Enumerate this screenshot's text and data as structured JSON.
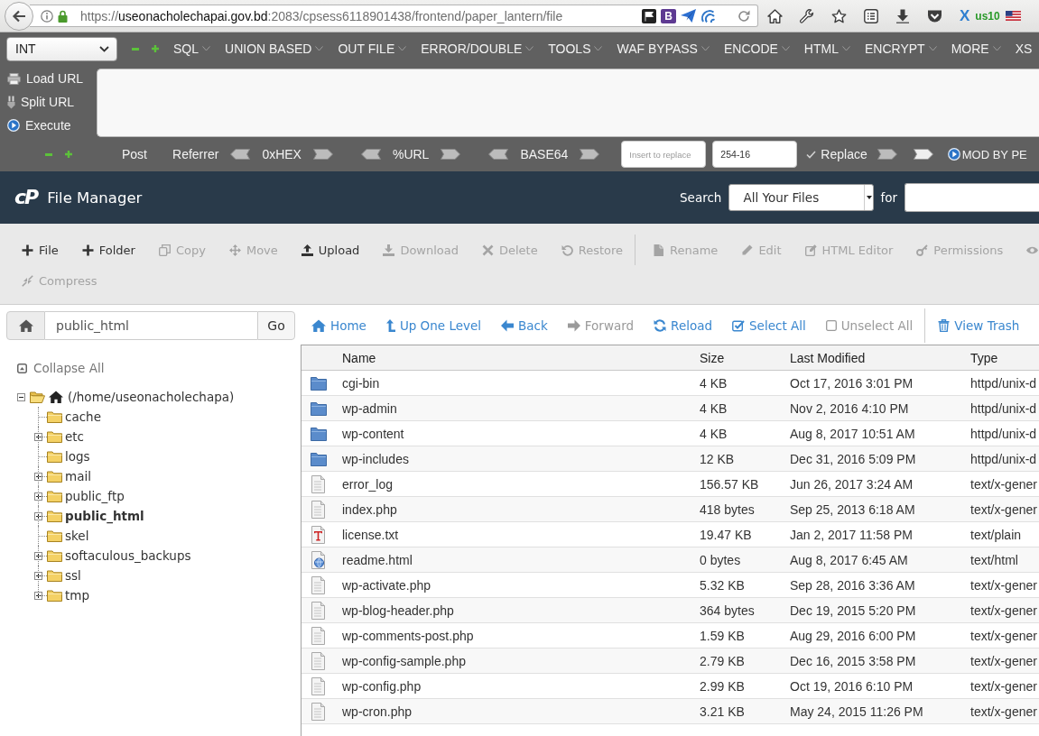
{
  "browser": {
    "url": {
      "scheme": "https://",
      "host": "useonacholechapai.gov.bd",
      "path": ":2083/cpsess6118901438/frontend/paper_lantern/file"
    },
    "extension_badge": "B",
    "extension_letter": "X",
    "vpn_label": "us10"
  },
  "hackbar": {
    "type_select": "INT",
    "menus": [
      {
        "label": "SQL",
        "caret": true
      },
      {
        "label": "UNION BASED",
        "caret": true
      },
      {
        "label": "OUT FILE",
        "caret": true
      },
      {
        "label": "ERROR/DOUBLE",
        "caret": true
      },
      {
        "label": "TOOLS",
        "caret": true
      },
      {
        "label": "WAF BYPASS",
        "caret": true
      },
      {
        "label": "ENCODE",
        "caret": true
      },
      {
        "label": "HTML",
        "caret": true
      },
      {
        "label": "ENCRYPT",
        "caret": true
      },
      {
        "label": "MORE",
        "caret": true
      },
      {
        "label": "XS",
        "caret": false
      }
    ],
    "actions": [
      {
        "kind": "load",
        "label": "Load URL"
      },
      {
        "kind": "split",
        "label": "Split URL"
      },
      {
        "kind": "execute",
        "label": "Execute"
      }
    ],
    "options": [
      {
        "kind": "toggle",
        "label": "Post"
      },
      {
        "kind": "toggle",
        "label": "Referrer"
      },
      {
        "kind": "codec",
        "label": "0xHEX"
      },
      {
        "kind": "codec",
        "label": "%URL"
      },
      {
        "kind": "codec",
        "label": "BASE64"
      },
      {
        "kind": "field",
        "placeholder": "Insert to replace"
      },
      {
        "kind": "field",
        "value": "254-16"
      },
      {
        "kind": "check",
        "label": "Replace",
        "checked": true
      },
      {
        "kind": "swap"
      },
      {
        "kind": "mod",
        "label": "MOD BY PE"
      }
    ]
  },
  "app_header": {
    "logo": "cP",
    "title": "File Manager",
    "search_label": "Search",
    "search_scope": "All Your Files",
    "for_label": "for"
  },
  "toolbar": [
    {
      "groups": [
        {
          "items": [
            {
              "kind": "plus",
              "label": "File",
              "disabled": false
            },
            {
              "kind": "plus",
              "label": "Folder",
              "disabled": false
            },
            {
              "kind": "copy",
              "label": "Copy",
              "disabled": true
            },
            {
              "kind": "move",
              "label": "Move",
              "disabled": true
            },
            {
              "kind": "upload",
              "label": "Upload",
              "disabled": false
            },
            {
              "kind": "download",
              "label": "Download",
              "disabled": true
            },
            {
              "kind": "delete",
              "label": "Delete",
              "disabled": true
            },
            {
              "kind": "restore",
              "label": "Restore",
              "disabled": true
            }
          ]
        },
        {
          "items": [
            {
              "kind": "rename",
              "label": "Rename",
              "disabled": true
            },
            {
              "kind": "edit",
              "label": "Edit",
              "disabled": true
            },
            {
              "kind": "html-editor",
              "label": "HTML Editor",
              "disabled": true
            },
            {
              "kind": "permissions",
              "label": "Permissions",
              "disabled": true
            },
            {
              "kind": "view",
              "disabled": true
            }
          ]
        }
      ]
    },
    {
      "groups": [
        {
          "items": [
            {
              "kind": "compress",
              "label": "Compress",
              "disabled": true
            }
          ]
        }
      ]
    }
  ],
  "path_bar": {
    "value": "public_html",
    "button": "Go"
  },
  "tree": {
    "collapse_all": "Collapse All",
    "root": {
      "label": "(/home/useonacholechapa)",
      "expanded": true,
      "selected": false,
      "children": [
        {
          "label": "cache",
          "expandable": false,
          "selected": false
        },
        {
          "label": "etc",
          "expandable": true,
          "selected": false
        },
        {
          "label": "logs",
          "expandable": false,
          "selected": false
        },
        {
          "label": "mail",
          "expandable": true,
          "selected": false
        },
        {
          "label": "public_ftp",
          "expandable": true,
          "selected": false
        },
        {
          "label": "public_html",
          "expandable": true,
          "selected": true
        },
        {
          "label": "skel",
          "expandable": false,
          "selected": false
        },
        {
          "label": "softaculous_backups",
          "expandable": true,
          "selected": false
        },
        {
          "label": "ssl",
          "expandable": true,
          "selected": false
        },
        {
          "label": "tmp",
          "expandable": true,
          "selected": false
        }
      ]
    }
  },
  "nav": {
    "groups": [
      {
        "items": [
          {
            "kind": "home",
            "label": "Home",
            "disabled": false
          },
          {
            "kind": "up",
            "label": "Up One Level",
            "disabled": false
          },
          {
            "kind": "back",
            "label": "Back",
            "disabled": false
          },
          {
            "kind": "forward",
            "label": "Forward",
            "disabled": true
          },
          {
            "kind": "reload",
            "label": "Reload",
            "disabled": false
          },
          {
            "kind": "select-all",
            "label": "Select All",
            "disabled": false
          },
          {
            "kind": "unselect-all",
            "label": "Unselect All",
            "disabled": true
          }
        ]
      },
      {
        "items": [
          {
            "kind": "trash",
            "label": "View Trash",
            "disabled": false
          }
        ]
      }
    ]
  },
  "table": {
    "columns": [
      "Name",
      "Size",
      "Last Modified",
      "Type"
    ],
    "rows": [
      {
        "kind": "folder",
        "name": "cgi-bin",
        "size": "4 KB",
        "modified": "Oct 17, 2016 3:01 PM",
        "type": "httpd/unix-d"
      },
      {
        "kind": "folder",
        "name": "wp-admin",
        "size": "4 KB",
        "modified": "Nov 2, 2016 4:10 PM",
        "type": "httpd/unix-d"
      },
      {
        "kind": "folder",
        "name": "wp-content",
        "size": "4 KB",
        "modified": "Aug 8, 2017 10:51 AM",
        "type": "httpd/unix-d"
      },
      {
        "kind": "folder",
        "name": "wp-includes",
        "size": "12 KB",
        "modified": "Dec 31, 2016 5:09 PM",
        "type": "httpd/unix-d"
      },
      {
        "kind": "file",
        "name": "error_log",
        "size": "156.57 KB",
        "modified": "Jun 26, 2017 3:24 AM",
        "type": "text/x-gener"
      },
      {
        "kind": "file",
        "name": "index.php",
        "size": "418 bytes",
        "modified": "Sep 25, 2013 6:18 AM",
        "type": "text/x-gener"
      },
      {
        "kind": "text",
        "name": "license.txt",
        "size": "19.47 KB",
        "modified": "Jan 2, 2017 11:58 PM",
        "type": "text/plain"
      },
      {
        "kind": "html",
        "name": "readme.html",
        "size": "0 bytes",
        "modified": "Aug 8, 2017 6:45 AM",
        "type": "text/html"
      },
      {
        "kind": "file",
        "name": "wp-activate.php",
        "size": "5.32 KB",
        "modified": "Sep 28, 2016 3:36 AM",
        "type": "text/x-gener"
      },
      {
        "kind": "file",
        "name": "wp-blog-header.php",
        "size": "364 bytes",
        "modified": "Dec 19, 2015 5:20 PM",
        "type": "text/x-gener"
      },
      {
        "kind": "file",
        "name": "wp-comments-post.php",
        "size": "1.59 KB",
        "modified": "Aug 29, 2016 6:00 PM",
        "type": "text/x-gener"
      },
      {
        "kind": "file",
        "name": "wp-config-sample.php",
        "size": "2.79 KB",
        "modified": "Dec 16, 2015 3:58 PM",
        "type": "text/x-gener"
      },
      {
        "kind": "file",
        "name": "wp-config.php",
        "size": "2.99 KB",
        "modified": "Oct 19, 2016 6:10 PM",
        "type": "text/x-gener"
      },
      {
        "kind": "file",
        "name": "wp-cron.php",
        "size": "3.21 KB",
        "modified": "May 24, 2015 11:26 PM",
        "type": "text/x-gener"
      }
    ]
  }
}
